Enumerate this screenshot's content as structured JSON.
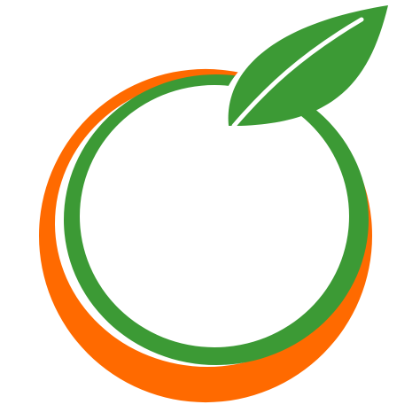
{
  "logo": {
    "icon": "orange-fruit-logo-icon",
    "colors": {
      "orange": "#FF6A00",
      "green": "#3C9A35",
      "background": "#FFFFFF"
    }
  }
}
